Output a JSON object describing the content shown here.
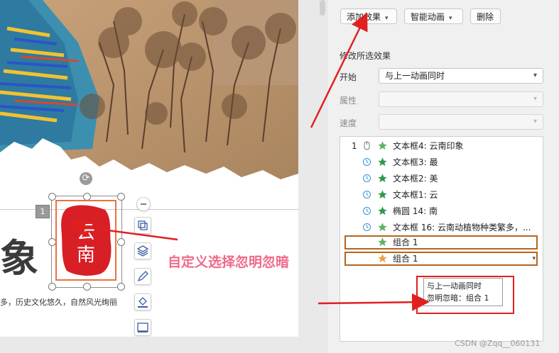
{
  "slide": {
    "title": "象",
    "description": "多，历史文化悠久，自然风光绚丽",
    "seal_text": "云南",
    "animation_number": "1",
    "rotate_icon": "rotate-icon"
  },
  "mini_toolbar": {
    "icons": [
      "collapse-icon",
      "crop-icon",
      "layers-icon",
      "pen-icon",
      "fill-icon",
      "frame-icon"
    ]
  },
  "panel": {
    "add_effect": "添加效果",
    "smart_anim": "智能动画",
    "delete": "删除",
    "section": "修改所选效果",
    "start_label": "开始",
    "start_value": "与上一动画同时",
    "property_label": "属性",
    "speed_label": "速度",
    "list": [
      {
        "num": "1",
        "icon": "mouse-icon",
        "star": "#5fb35f",
        "text": "文本框4: 云南印象"
      },
      {
        "num": "",
        "icon": "clock-icon",
        "star": "#2e9a4a",
        "text": "文本框3: 最"
      },
      {
        "num": "",
        "icon": "clock-icon",
        "star": "#2e9a4a",
        "text": "文本框2: 美"
      },
      {
        "num": "",
        "icon": "clock-icon",
        "star": "#2e9a4a",
        "text": "文本框1: 云"
      },
      {
        "num": "",
        "icon": "clock-icon",
        "star": "#2e9a4a",
        "text": "椭圆 14: 南"
      },
      {
        "num": "",
        "icon": "clock-icon",
        "star": "#5fb35f",
        "text": "文本框 16: 云南动植物种类繁多，..."
      },
      {
        "num": "",
        "icon": "",
        "star": "#5fb35f",
        "text": "组合 1"
      },
      {
        "num": "",
        "icon": "",
        "star": "#f0a040",
        "text": "组合 1"
      }
    ],
    "tooltip_line1": "与上一动画同时",
    "tooltip_line2": "忽明忽暗：组合 1"
  },
  "annotation": "自定义选择忽明忽暗",
  "watermark": "CSDN @Zqq__060131",
  "colors": {
    "accent": "#e02020",
    "annotation": "#f06a8a",
    "highlight_border": "#b5651d",
    "seal_red": "#d81f26"
  }
}
